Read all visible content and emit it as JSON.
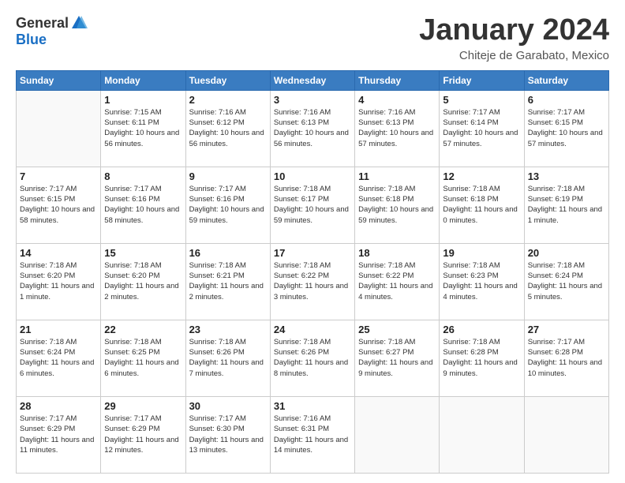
{
  "logo": {
    "general": "General",
    "blue": "Blue"
  },
  "title": "January 2024",
  "subtitle": "Chiteje de Garabato, Mexico",
  "days_header": [
    "Sunday",
    "Monday",
    "Tuesday",
    "Wednesday",
    "Thursday",
    "Friday",
    "Saturday"
  ],
  "weeks": [
    [
      {
        "day": "",
        "sunrise": "",
        "sunset": "",
        "daylight": ""
      },
      {
        "day": "1",
        "sunrise": "7:15 AM",
        "sunset": "6:11 PM",
        "daylight": "10 hours and 56 minutes."
      },
      {
        "day": "2",
        "sunrise": "7:16 AM",
        "sunset": "6:12 PM",
        "daylight": "10 hours and 56 minutes."
      },
      {
        "day": "3",
        "sunrise": "7:16 AM",
        "sunset": "6:13 PM",
        "daylight": "10 hours and 56 minutes."
      },
      {
        "day": "4",
        "sunrise": "7:16 AM",
        "sunset": "6:13 PM",
        "daylight": "10 hours and 57 minutes."
      },
      {
        "day": "5",
        "sunrise": "7:17 AM",
        "sunset": "6:14 PM",
        "daylight": "10 hours and 57 minutes."
      },
      {
        "day": "6",
        "sunrise": "7:17 AM",
        "sunset": "6:15 PM",
        "daylight": "10 hours and 57 minutes."
      }
    ],
    [
      {
        "day": "7",
        "sunrise": "7:17 AM",
        "sunset": "6:15 PM",
        "daylight": "10 hours and 58 minutes."
      },
      {
        "day": "8",
        "sunrise": "7:17 AM",
        "sunset": "6:16 PM",
        "daylight": "10 hours and 58 minutes."
      },
      {
        "day": "9",
        "sunrise": "7:17 AM",
        "sunset": "6:16 PM",
        "daylight": "10 hours and 59 minutes."
      },
      {
        "day": "10",
        "sunrise": "7:18 AM",
        "sunset": "6:17 PM",
        "daylight": "10 hours and 59 minutes."
      },
      {
        "day": "11",
        "sunrise": "7:18 AM",
        "sunset": "6:18 PM",
        "daylight": "10 hours and 59 minutes."
      },
      {
        "day": "12",
        "sunrise": "7:18 AM",
        "sunset": "6:18 PM",
        "daylight": "11 hours and 0 minutes."
      },
      {
        "day": "13",
        "sunrise": "7:18 AM",
        "sunset": "6:19 PM",
        "daylight": "11 hours and 1 minute."
      }
    ],
    [
      {
        "day": "14",
        "sunrise": "7:18 AM",
        "sunset": "6:20 PM",
        "daylight": "11 hours and 1 minute."
      },
      {
        "day": "15",
        "sunrise": "7:18 AM",
        "sunset": "6:20 PM",
        "daylight": "11 hours and 2 minutes."
      },
      {
        "day": "16",
        "sunrise": "7:18 AM",
        "sunset": "6:21 PM",
        "daylight": "11 hours and 2 minutes."
      },
      {
        "day": "17",
        "sunrise": "7:18 AM",
        "sunset": "6:22 PM",
        "daylight": "11 hours and 3 minutes."
      },
      {
        "day": "18",
        "sunrise": "7:18 AM",
        "sunset": "6:22 PM",
        "daylight": "11 hours and 4 minutes."
      },
      {
        "day": "19",
        "sunrise": "7:18 AM",
        "sunset": "6:23 PM",
        "daylight": "11 hours and 4 minutes."
      },
      {
        "day": "20",
        "sunrise": "7:18 AM",
        "sunset": "6:24 PM",
        "daylight": "11 hours and 5 minutes."
      }
    ],
    [
      {
        "day": "21",
        "sunrise": "7:18 AM",
        "sunset": "6:24 PM",
        "daylight": "11 hours and 6 minutes."
      },
      {
        "day": "22",
        "sunrise": "7:18 AM",
        "sunset": "6:25 PM",
        "daylight": "11 hours and 6 minutes."
      },
      {
        "day": "23",
        "sunrise": "7:18 AM",
        "sunset": "6:26 PM",
        "daylight": "11 hours and 7 minutes."
      },
      {
        "day": "24",
        "sunrise": "7:18 AM",
        "sunset": "6:26 PM",
        "daylight": "11 hours and 8 minutes."
      },
      {
        "day": "25",
        "sunrise": "7:18 AM",
        "sunset": "6:27 PM",
        "daylight": "11 hours and 9 minutes."
      },
      {
        "day": "26",
        "sunrise": "7:18 AM",
        "sunset": "6:28 PM",
        "daylight": "11 hours and 9 minutes."
      },
      {
        "day": "27",
        "sunrise": "7:17 AM",
        "sunset": "6:28 PM",
        "daylight": "11 hours and 10 minutes."
      }
    ],
    [
      {
        "day": "28",
        "sunrise": "7:17 AM",
        "sunset": "6:29 PM",
        "daylight": "11 hours and 11 minutes."
      },
      {
        "day": "29",
        "sunrise": "7:17 AM",
        "sunset": "6:29 PM",
        "daylight": "11 hours and 12 minutes."
      },
      {
        "day": "30",
        "sunrise": "7:17 AM",
        "sunset": "6:30 PM",
        "daylight": "11 hours and 13 minutes."
      },
      {
        "day": "31",
        "sunrise": "7:16 AM",
        "sunset": "6:31 PM",
        "daylight": "11 hours and 14 minutes."
      },
      {
        "day": "",
        "sunrise": "",
        "sunset": "",
        "daylight": ""
      },
      {
        "day": "",
        "sunrise": "",
        "sunset": "",
        "daylight": ""
      },
      {
        "day": "",
        "sunrise": "",
        "sunset": "",
        "daylight": ""
      }
    ]
  ]
}
